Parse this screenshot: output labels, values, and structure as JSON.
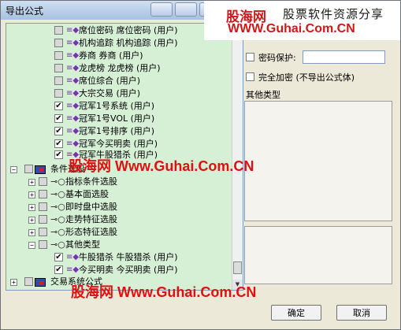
{
  "window": {
    "title": "导出公式"
  },
  "tree": {
    "rows": [
      {
        "text": "席位密码  席位密码 (用户)",
        "checked": false,
        "icon": "formula-icon",
        "expander": ""
      },
      {
        "text": "机构追踪  机构追踪 (用户)",
        "checked": false,
        "icon": "formula-icon",
        "expander": ""
      },
      {
        "text": "券商  券商 (用户)",
        "checked": false,
        "icon": "formula-icon",
        "expander": ""
      },
      {
        "text": "龙虎榜  龙虎榜 (用户)",
        "checked": false,
        "icon": "formula-icon",
        "expander": ""
      },
      {
        "text": "席位综合  (用户)",
        "checked": false,
        "icon": "formula-icon",
        "expander": ""
      },
      {
        "text": "大宗交易  (用户)",
        "checked": false,
        "icon": "formula-icon",
        "expander": ""
      },
      {
        "text": "冠军1号系统  (用户)",
        "checked": true,
        "icon": "formula-icon",
        "expander": ""
      },
      {
        "text": "冠军1号VOL  (用户)",
        "checked": true,
        "icon": "formula-icon",
        "expander": ""
      },
      {
        "text": "冠军1号排序  (用户)",
        "checked": true,
        "icon": "formula-icon",
        "expander": ""
      },
      {
        "text": "冠军今买明卖  (用户)",
        "checked": true,
        "icon": "formula-icon",
        "expander": ""
      },
      {
        "text": "冠军牛股猎杀  (用户)",
        "checked": true,
        "icon": "formula-icon",
        "expander": ""
      },
      {
        "text": "条件选股",
        "checked": false,
        "icon": "module-icon",
        "expander": "−"
      },
      {
        "text": "指标条件选股",
        "checked": false,
        "icon": "key-icon",
        "expander": "+"
      },
      {
        "text": "基本面选股",
        "checked": false,
        "icon": "key-icon",
        "expander": "+"
      },
      {
        "text": "即时盘中选股",
        "checked": false,
        "icon": "key-icon",
        "expander": "+"
      },
      {
        "text": "走势特征选股",
        "checked": false,
        "icon": "key-icon",
        "expander": "+"
      },
      {
        "text": "形态特征选股",
        "checked": false,
        "icon": "key-icon",
        "expander": "+"
      },
      {
        "text": "其他类型",
        "checked": false,
        "icon": "key-icon",
        "expander": "−"
      },
      {
        "text": "牛股猎杀  牛股猎杀 (用户)",
        "checked": true,
        "icon": "formula-icon",
        "expander": ""
      },
      {
        "text": "今买明卖  今买明卖 (用户)",
        "checked": true,
        "icon": "formula-icon",
        "expander": ""
      },
      {
        "text": "交易系统公式",
        "checked": false,
        "icon": "module-icon",
        "expander": "+"
      }
    ]
  },
  "options": {
    "password_label": "密码保护:",
    "password_value": "",
    "encrypt_label": "完全加密 (不导出公式体)",
    "category_label": "其他类型"
  },
  "buttons": {
    "ok": "确定",
    "cancel": "取消"
  },
  "watermarks": {
    "top_logo": "股海网",
    "top_tagline": "股票软件资源分享",
    "top_url": "WWW.Guhai.Com.CN",
    "mid_logo": "股海网",
    "mid_url": "Www.Guhai.Com.CN",
    "bottom_logo": "股海网",
    "bottom_url": "Www.Guhai.Com.CN"
  },
  "colors": {
    "tree_bg": "#d6f0d6",
    "watermark_red": "#e01010",
    "dialog_bg": "#ece9d8"
  }
}
